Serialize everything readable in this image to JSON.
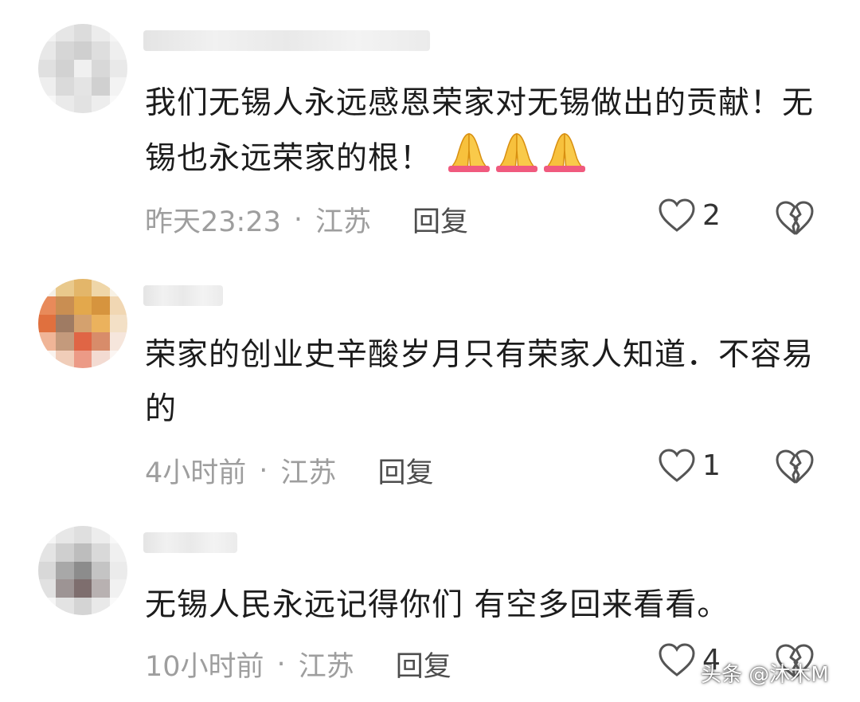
{
  "comments": [
    {
      "text": "我们无锡人永远感恩荣家对无锡做出的贡献！无锡也永远荣家的根！",
      "emoji": "pray-hands x3",
      "time": "昨天23:23",
      "separator": "·",
      "region": "江苏",
      "reply_label": "回复",
      "likes": "2"
    },
    {
      "text": "荣家的创业史辛酸岁月只有荣家人知道．不容易的",
      "time": "4小时前",
      "separator": "·",
      "region": "江苏",
      "reply_label": "回复",
      "likes": "1"
    },
    {
      "text": "无锡人民永远记得你们 有空多回来看看。",
      "time": "10小时前",
      "separator": "·",
      "region": "江苏",
      "reply_label": "回复",
      "likes": "4"
    }
  ],
  "watermark": "头条 @沐木M",
  "colors": {
    "meta": "#9e9e9e",
    "reply": "#4d4d4d",
    "icon": "#555555"
  }
}
